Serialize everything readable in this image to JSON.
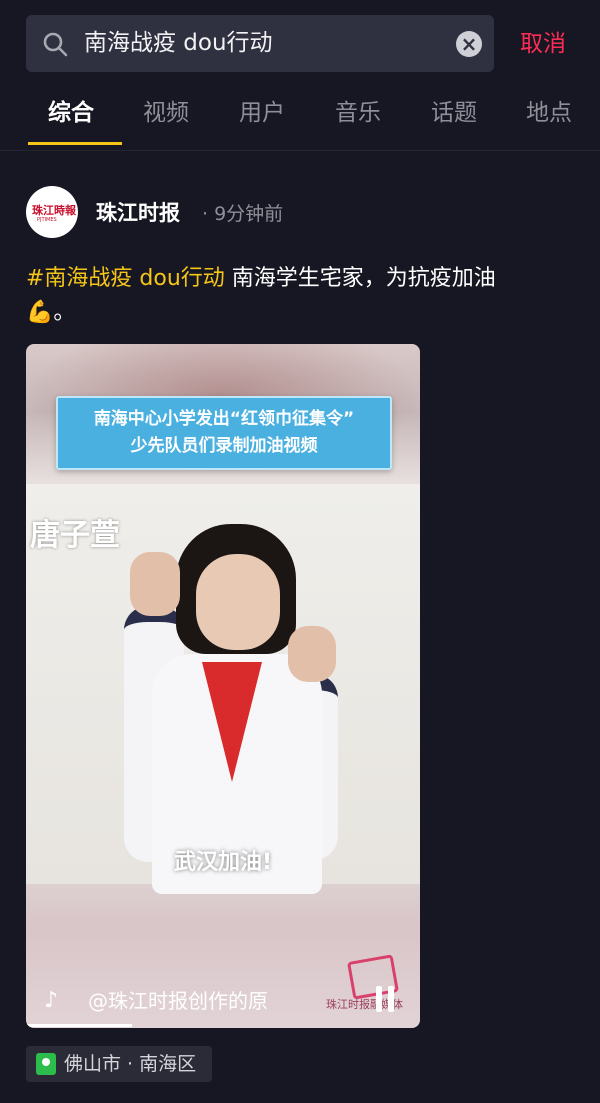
{
  "search": {
    "query": "南海战疫 dou行动",
    "cancel_label": "取消"
  },
  "tabs": [
    {
      "label": "综合",
      "active": true
    },
    {
      "label": "视频",
      "active": false
    },
    {
      "label": "用户",
      "active": false
    },
    {
      "label": "音乐",
      "active": false
    },
    {
      "label": "话题",
      "active": false
    },
    {
      "label": "地点",
      "active": false
    }
  ],
  "post": {
    "author": "珠江时报",
    "time": "· 9分钟前",
    "avatar_text": "珠江時報",
    "avatar_subtext": "PJTIMES",
    "hashtag": "#南海战疫 dou行动",
    "caption_text": " 南海学生宅家，为抗疫加油",
    "caption_emoji": "💪。",
    "video": {
      "banner_line1": "南海中心小学发出“红领巾征集令”",
      "banner_line2": "少先队员们录制加油视频",
      "name_tag": "唐子萱",
      "slogan": "武汉加油!",
      "creator": "@珠江时报创作的原",
      "watermark": "珠江时报融媒体",
      "progress_fraction": 0.27
    },
    "location": "佛山市 · 南海区"
  },
  "colors": {
    "background": "#161722",
    "accent_red": "#fe2c55",
    "hashtag_yellow": "#f5c518",
    "tab_inactive": "#8e8f98"
  }
}
